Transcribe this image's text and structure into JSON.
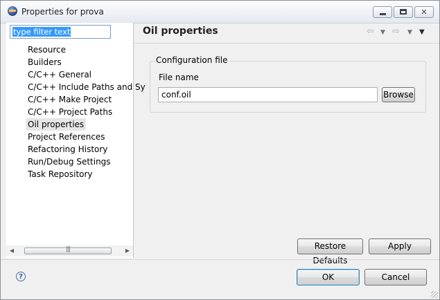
{
  "window": {
    "title": "Properties for prova"
  },
  "filter": {
    "value": "type filter text"
  },
  "tree": {
    "items": [
      "Resource",
      "Builders",
      "C/C++ General",
      "C/C++ Include Paths and Sy",
      "C/C++ Make Project",
      "C/C++ Project Paths",
      "Oil properties",
      "Project References",
      "Refactoring History",
      "Run/Debug Settings",
      "Task Repository"
    ],
    "selected": "Oil properties"
  },
  "page": {
    "title": "Oil properties",
    "group_title": "Configuration file",
    "file_label": "File name",
    "file_value": "conf.oil",
    "browse_label": "Browse"
  },
  "buttons": {
    "restore": "Restore Defaults",
    "apply": "Apply",
    "ok": "OK",
    "cancel": "Cancel",
    "help": "?"
  },
  "icons": {
    "back": "back-arrow-icon",
    "forward": "forward-arrow-icon",
    "menu": "view-menu-icon"
  }
}
